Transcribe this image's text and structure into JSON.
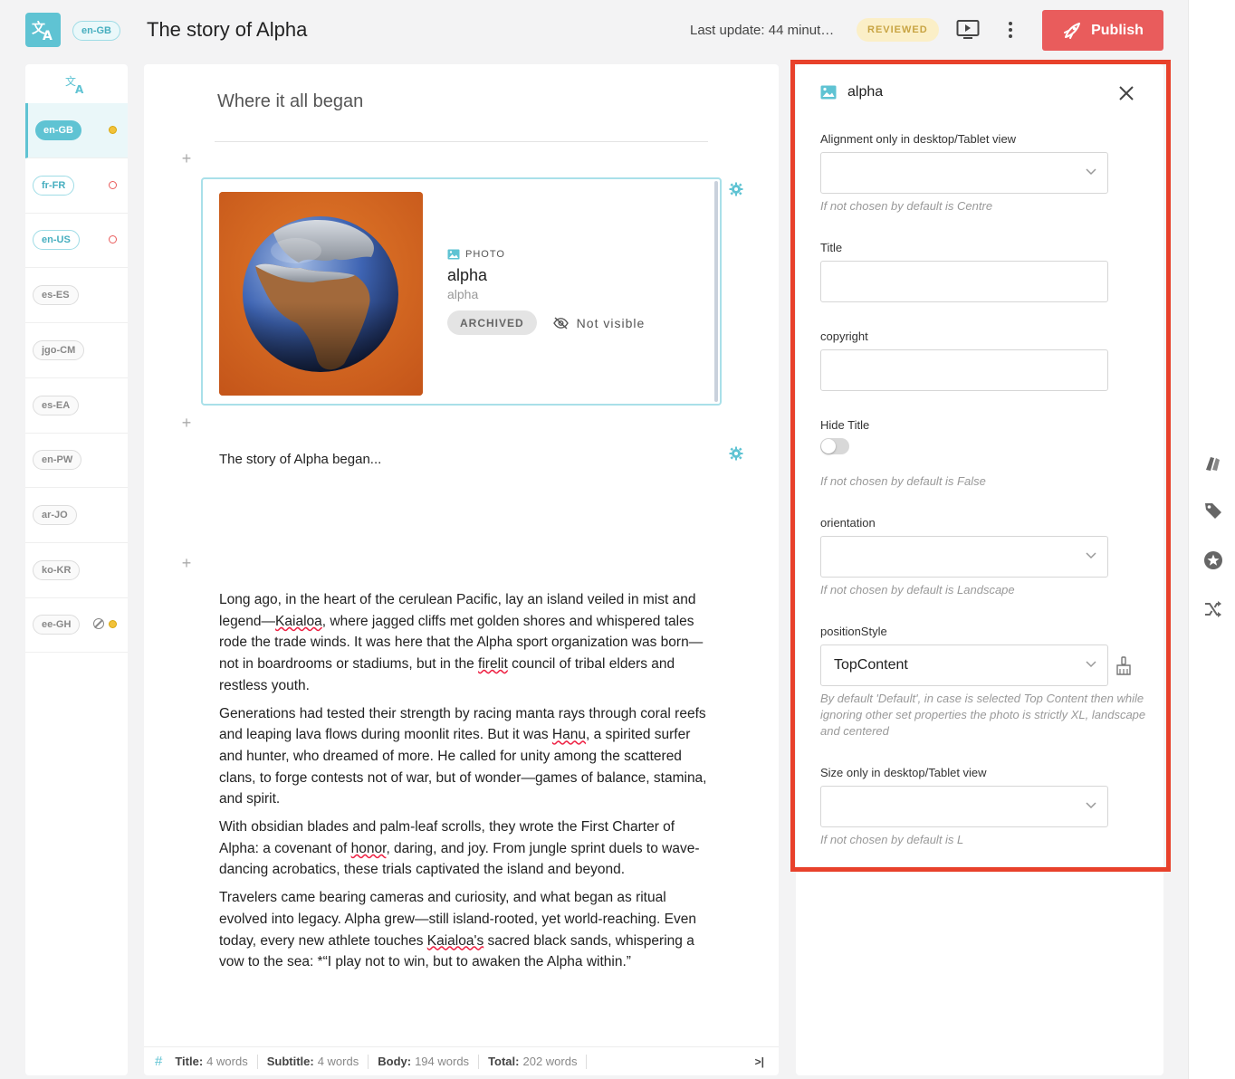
{
  "header": {
    "locale": "en-GB",
    "title": "The story of Alpha",
    "last_update": "Last update: 44 minut…",
    "status": "REVIEWED",
    "publish_label": "Publish"
  },
  "sidebar": {
    "items": [
      {
        "code": "en-GB",
        "style": "filled",
        "status": "yellow"
      },
      {
        "code": "fr-FR",
        "style": "outlined",
        "status": "red"
      },
      {
        "code": "en-US",
        "style": "outlined",
        "status": "red"
      },
      {
        "code": "es-ES",
        "style": "grey",
        "status": ""
      },
      {
        "code": "jgo-CM",
        "style": "grey",
        "status": ""
      },
      {
        "code": "es-EA",
        "style": "grey",
        "status": ""
      },
      {
        "code": "en-PW",
        "style": "grey",
        "status": ""
      },
      {
        "code": "ar-JO",
        "style": "grey",
        "status": ""
      },
      {
        "code": "ko-KR",
        "style": "grey",
        "status": ""
      },
      {
        "code": "ee-GH",
        "style": "grey",
        "status": "banned-yellow"
      }
    ]
  },
  "editor": {
    "subtitle": "Where it all began",
    "photo": {
      "type": "PHOTO",
      "name": "alpha",
      "sub": "alpha",
      "badge": "ARCHIVED",
      "visibility": "Not visible"
    },
    "intro": "The story of Alpha began...",
    "paragraphs": [
      [
        "Long ago, in the heart of the cerulean Pacific, lay an island veiled in mist and legend—",
        {
          "s": "Kaialoa"
        },
        ", where jagged cliffs met golden shores and whispered tales rode the trade winds. It was here that the Alpha sport organization was born—not in boardrooms or stadiums, but in the ",
        {
          "s": "firelit"
        },
        " council of tribal elders and restless youth."
      ],
      [
        "Generations had tested their strength by racing manta rays through coral reefs and leaping lava flows during moonlit rites. But it was ",
        {
          "s": "Hanu"
        },
        ", a spirited surfer and hunter, who dreamed of more. He called for unity among the scattered clans, to forge contests not of war, but of wonder—games of balance, stamina, and spirit."
      ],
      [
        "With obsidian blades and palm-leaf scrolls, they wrote the First Charter of Alpha: a covenant of ",
        {
          "s": "honor"
        },
        ", daring, and joy. From jungle sprint duels to wave-dancing acrobatics, these trials captivated the island and beyond."
      ],
      [
        "Travelers came bearing cameras and curiosity, and what began as ritual evolved into legacy. Alpha grew—still island-rooted, yet world-reaching. Even today, every new athlete touches ",
        {
          "s": "Kaialoa's"
        },
        " sacred black sands, whispering a vow to the sea: *“I play not to win, but to awaken the Alpha within.”"
      ]
    ],
    "word_count": {
      "title_label": "Title:",
      "title_value": "4 words",
      "subtitle_label": "Subtitle:",
      "subtitle_value": "4 words",
      "body_label": "Body:",
      "body_value": "194 words",
      "total_label": "Total:",
      "total_value": "202 words"
    }
  },
  "panel": {
    "title": "alpha",
    "fields": {
      "alignment_label": "Alignment only in desktop/Tablet view",
      "alignment_hint": "If not chosen by default is Centre",
      "title_label": "Title",
      "copyright_label": "copyright",
      "hide_title_label": "Hide Title",
      "hide_title_hint": "If not chosen by default is False",
      "orientation_label": "orientation",
      "orientation_hint": "If not chosen by default is Landscape",
      "position_style_label": "positionStyle",
      "position_style_value": "TopContent",
      "position_style_hint": "By default 'Default', in case is selected Top Content then while ignoring other set properties the photo is strictly XL, landscape and centered",
      "size_label": "Size only in desktop/Tablet view",
      "size_hint": "If not chosen by default is L"
    }
  },
  "colors": {
    "accent": "#5fc3d3",
    "publish": "#e95c5c",
    "highlight": "#e8412b",
    "reviewed_bg": "#fbefc7"
  }
}
